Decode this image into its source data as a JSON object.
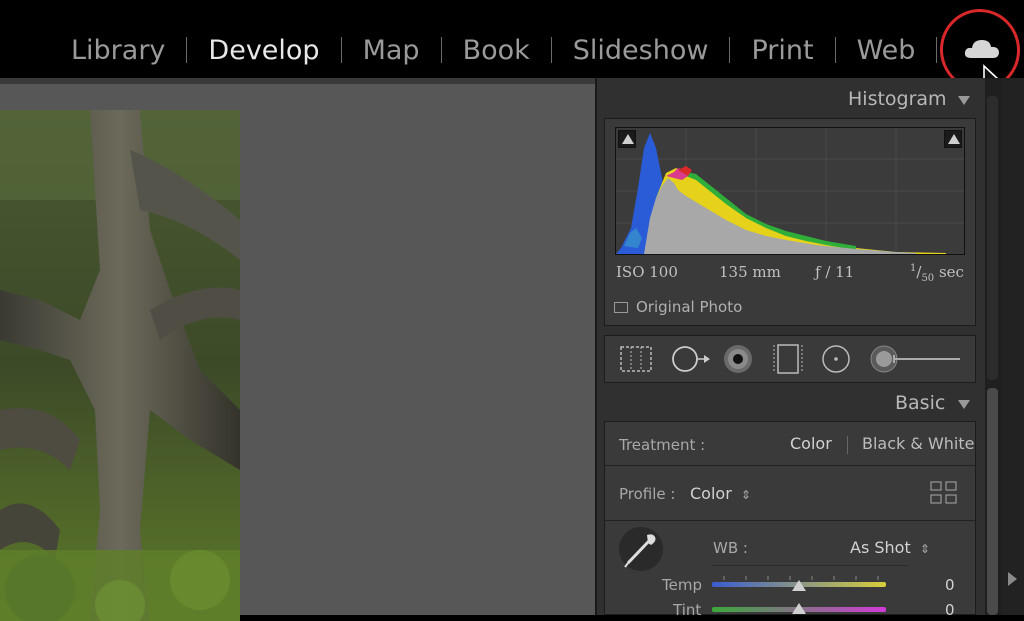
{
  "modules": [
    {
      "label": "Library",
      "active": false
    },
    {
      "label": "Develop",
      "active": true
    },
    {
      "label": "Map",
      "active": false
    },
    {
      "label": "Book",
      "active": false
    },
    {
      "label": "Slideshow",
      "active": false
    },
    {
      "label": "Print",
      "active": false
    },
    {
      "label": "Web",
      "active": false
    }
  ],
  "cloud_icon": "cloud-icon",
  "histogram": {
    "title": "Histogram",
    "iso": "ISO 100",
    "focal": "135 mm",
    "aperture": "ƒ / 11",
    "shutter_num": "1",
    "shutter_den": "50",
    "shutter_unit": "sec",
    "original_photo": "Original Photo"
  },
  "tools": [
    "crop-overlay-icon",
    "spot-removal-icon",
    "red-eye-icon",
    "graduated-filter-icon",
    "radial-filter-icon",
    "adjustment-brush-icon"
  ],
  "basic": {
    "title": "Basic",
    "treatment_label": "Treatment :",
    "treatment_color": "Color",
    "treatment_bw": "Black & White",
    "profile_label": "Profile :",
    "profile_value": "Color",
    "wb_label": "WB :",
    "wb_value": "As Shot",
    "temp_label": "Temp",
    "temp_value": "0",
    "tint_label": "Tint",
    "tint_value": "0"
  },
  "colors": {
    "accent_red": "#d8282a",
    "histogram_blue": "#2a5cd8",
    "histogram_yellow": "#e6d21a",
    "histogram_green": "#2fae3a",
    "histogram_magenta": "#d82a9a"
  }
}
